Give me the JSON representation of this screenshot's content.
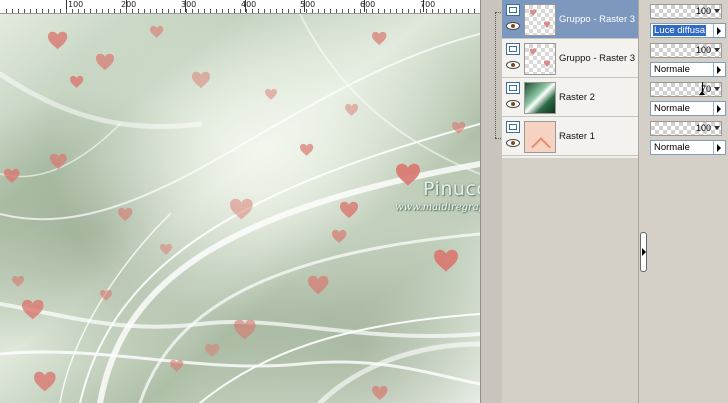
{
  "ruler": {
    "labels": [
      "100",
      "200",
      "300",
      "400",
      "500",
      "600",
      "700"
    ]
  },
  "watermark": {
    "name": "Pinuccia",
    "url": "www.maidiregrafica.eu"
  },
  "layers": [
    {
      "name": "Gruppo - Raster 3",
      "selected": true,
      "thumb": "hearts",
      "opacity": "100",
      "blend": "Luce diffusa",
      "blend_highlighted": true
    },
    {
      "name": "Gruppo - Raster 3",
      "selected": false,
      "thumb": "hearts",
      "opacity": "100",
      "blend": "Normale",
      "blend_highlighted": false
    },
    {
      "name": "Raster 2",
      "selected": false,
      "thumb": "green",
      "opacity": "70",
      "blend": "Normale",
      "blend_highlighted": false
    },
    {
      "name": "Raster 1",
      "selected": false,
      "thumb": "peach",
      "opacity": "100",
      "blend": "Normale",
      "blend_highlighted": false
    }
  ],
  "colors": {
    "selection": "#7c98bf",
    "canvas_base": "#c9d6c4",
    "heart": "#d9776f"
  }
}
